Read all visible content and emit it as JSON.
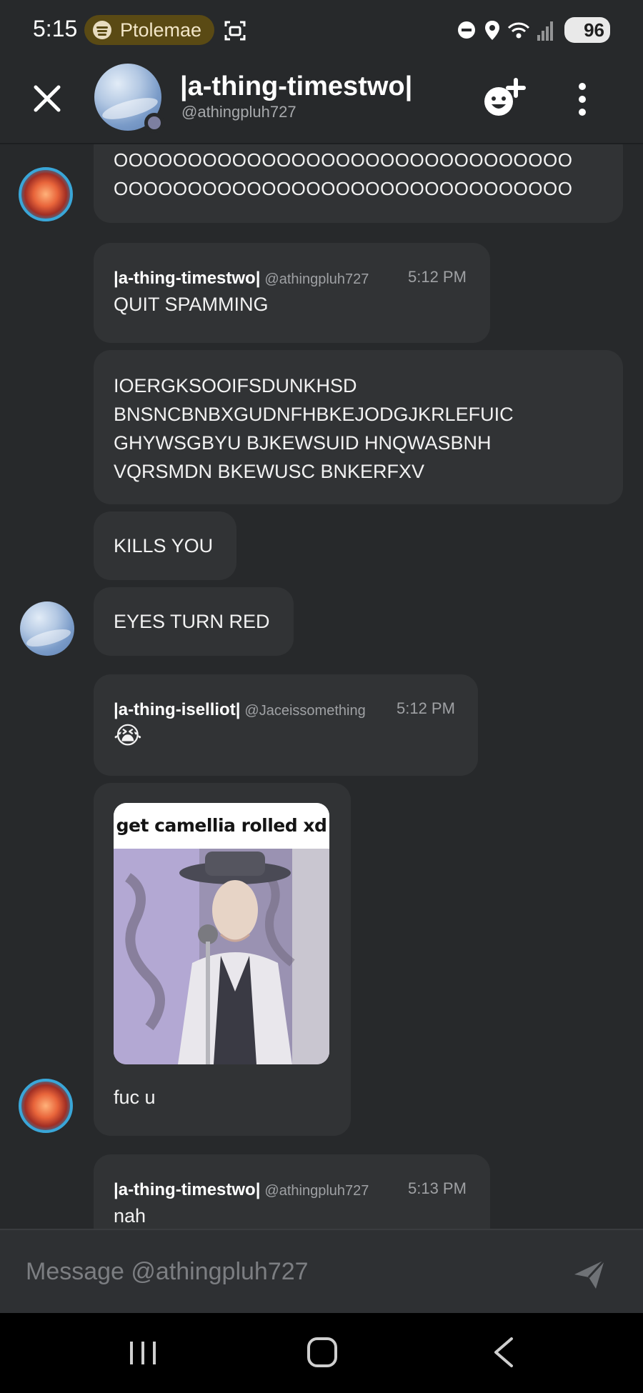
{
  "status_bar": {
    "time": "5:15",
    "media_app": "Ptolemae",
    "battery": "96"
  },
  "header": {
    "display_name": "|a-thing-timestwo|",
    "handle": "@athingpluh727"
  },
  "messages": [
    {
      "text": "OOOOOOOOOOOOOOOOOOOOOOOOOOOOOOO\nOOOOOOOOOOOOOOOOOOOOOOOOOOOOOOO"
    },
    {
      "author": "|a-thing-timestwo|",
      "handle": "@athingpluh727",
      "time": "5:12 PM",
      "text": "QUIT SPAMMING"
    },
    {
      "text": "IOERGKSOOIFSDUNKHSD\nBNSNCBNBXGUDNFHBKEJODGJKRLEFUIC\nGHYWSGBYU BJKEWSUID HNQWASBNH\nVQRSMDN BKEWUSC BNKERFXV"
    },
    {
      "text": "KILLS YOU"
    },
    {
      "text": "EYES TURN RED"
    },
    {
      "author": "|a-thing-iselliot|",
      "handle": "@Jaceissomething",
      "time": "5:12 PM",
      "text": "😭"
    },
    {
      "gif_caption": "get camellia rolled xd",
      "text": "fuc u"
    },
    {
      "author": "|a-thing-timestwo|",
      "handle": "@athingpluh727",
      "time": "5:13 PM",
      "text": "nah"
    }
  ],
  "composer": {
    "placeholder": "Message @athingpluh727"
  },
  "icons": {
    "close": "close-icon",
    "add_friend": "add-friend-icon",
    "more": "more-vertical-icon",
    "send": "send-icon",
    "spotify": "spotify-icon"
  }
}
